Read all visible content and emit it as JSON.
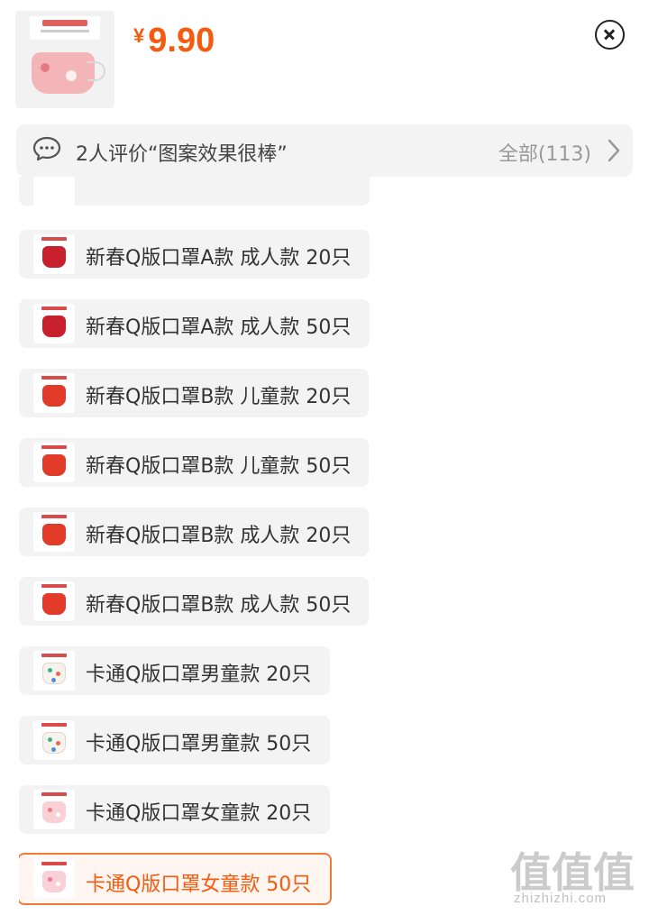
{
  "product": {
    "thumbnail_icon": "mask-package-thumbnail",
    "currency_symbol": "¥",
    "price": "9.90"
  },
  "close_icon": "close-circle-icon",
  "review_bar": {
    "icon": "chat-bubble-icon",
    "summary": "2人评价“图案效果很棒”",
    "all_label": "全部(113)",
    "chevron_icon": "chevron-right-icon"
  },
  "options": [
    {
      "label": "新春Q版口罩A款 成人款 20只",
      "variant": "v-a",
      "selected": false
    },
    {
      "label": "新春Q版口罩A款 成人款 50只",
      "variant": "v-a",
      "selected": false
    },
    {
      "label": "新春Q版口罩B款 儿童款 20只",
      "variant": "v-b",
      "selected": false
    },
    {
      "label": "新春Q版口罩B款 儿童款 50只",
      "variant": "v-b",
      "selected": false
    },
    {
      "label": "新春Q版口罩B款 成人款 20只",
      "variant": "v-b",
      "selected": false
    },
    {
      "label": "新春Q版口罩B款 成人款 50只",
      "variant": "v-b",
      "selected": false
    },
    {
      "label": "卡通Q版口罩男童款 20只",
      "variant": "v-boy",
      "selected": false
    },
    {
      "label": "卡通Q版口罩男童款 50只",
      "variant": "v-boy",
      "selected": false
    },
    {
      "label": "卡通Q版口罩女童款 20只",
      "variant": "v-girl",
      "selected": false
    },
    {
      "label": "卡通Q版口罩女童款 50只",
      "variant": "v-girl",
      "selected": true
    }
  ],
  "watermark": {
    "big": "值值值",
    "small": "zhizhizhi.com"
  },
  "colors": {
    "price": "#f55b0f",
    "selected_border": "#f07a3c",
    "chip_background": "#f3f3f3"
  }
}
